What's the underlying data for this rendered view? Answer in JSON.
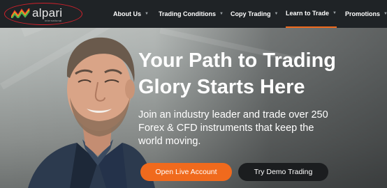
{
  "brand": {
    "name": "alpari",
    "sub": "international",
    "highlight_color": "#d0212b",
    "mark_colors": [
      "#e63b2e",
      "#f7a21b",
      "#4caf50"
    ]
  },
  "nav": {
    "items": [
      {
        "label": "About Us",
        "caret": "▼"
      },
      {
        "label": "Trading Conditions",
        "caret": "▼"
      },
      {
        "label": "Copy Trading",
        "caret": "▼"
      },
      {
        "label": "Learn to Trade",
        "caret": "▼"
      },
      {
        "label": "Promotions",
        "caret": "▼"
      }
    ],
    "active_index": 3,
    "accent_color": "#f06a1d"
  },
  "hero": {
    "headline_line1": "Your Path to Trading",
    "headline_line2": "Glory Starts Here",
    "subhead_line1": "Join an industry leader and trade over 250",
    "subhead_line2": "Forex & CFD instruments that keep the",
    "subhead_line3": "world moving.",
    "primary_cta": "Open Live Account",
    "secondary_cta": "Try Demo Trading"
  },
  "colors": {
    "nav_bg": "#1f2326",
    "primary_button": "#f06a1d",
    "secondary_button": "#1b1d1f"
  }
}
